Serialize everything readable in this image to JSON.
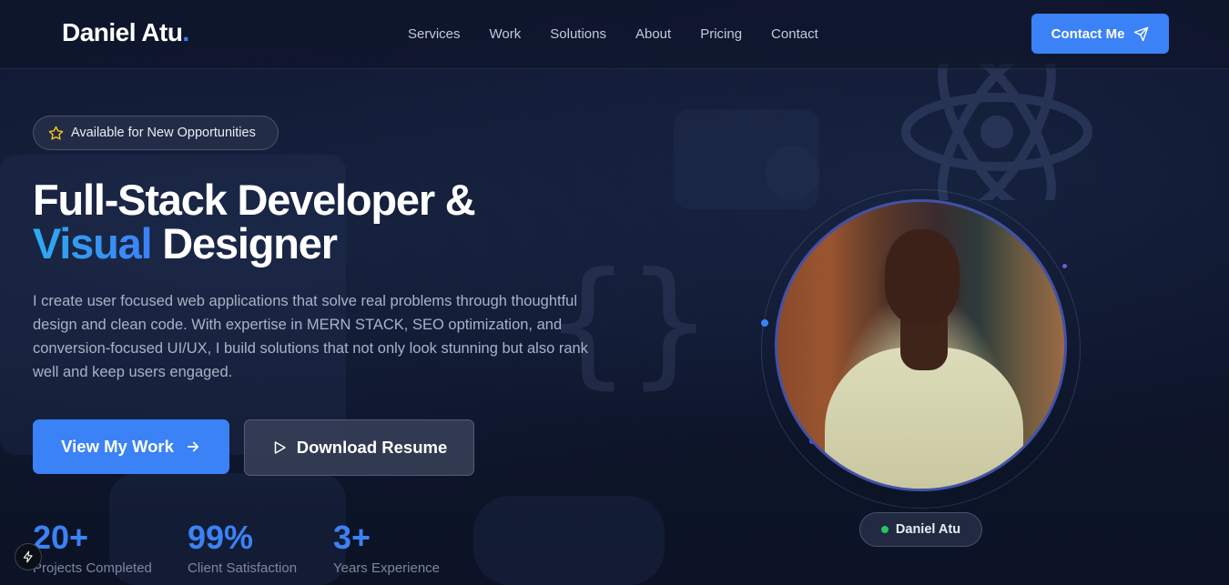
{
  "header": {
    "logo_text": "Daniel Atu",
    "logo_dot": ".",
    "nav": [
      "Services",
      "Work",
      "Solutions",
      "About",
      "Pricing",
      "Contact"
    ],
    "contact_button": "Contact Me"
  },
  "hero": {
    "badge": "Available for New Opportunities",
    "headline_line1": "Full-Stack Developer &",
    "headline_accent": "Visual",
    "headline_line2_rest": "Designer",
    "intro": "I create user focused web applications that solve real problems through thoughtful design and clean code. With expertise in MERN STACK, SEO optimization, and conversion-focused UI/UX, I build solutions that not only look stunning but also rank well and keep users engaged.",
    "primary_button": "View My Work",
    "secondary_button": "Download Resume",
    "stats": [
      {
        "value": "20+",
        "label": "Projects Completed"
      },
      {
        "value": "99%",
        "label": "Client Satisfaction"
      },
      {
        "value": "3+",
        "label": "Years Experience"
      }
    ]
  },
  "profile": {
    "name": "Daniel Atu",
    "status_color": "#22c55e"
  },
  "colors": {
    "accent": "#3b82f6",
    "background": "#0d1428"
  },
  "icons": {
    "contact": "send-icon",
    "badge": "star-icon",
    "primary": "arrow-right-icon",
    "secondary": "play-icon",
    "corner": "lightning-icon"
  }
}
